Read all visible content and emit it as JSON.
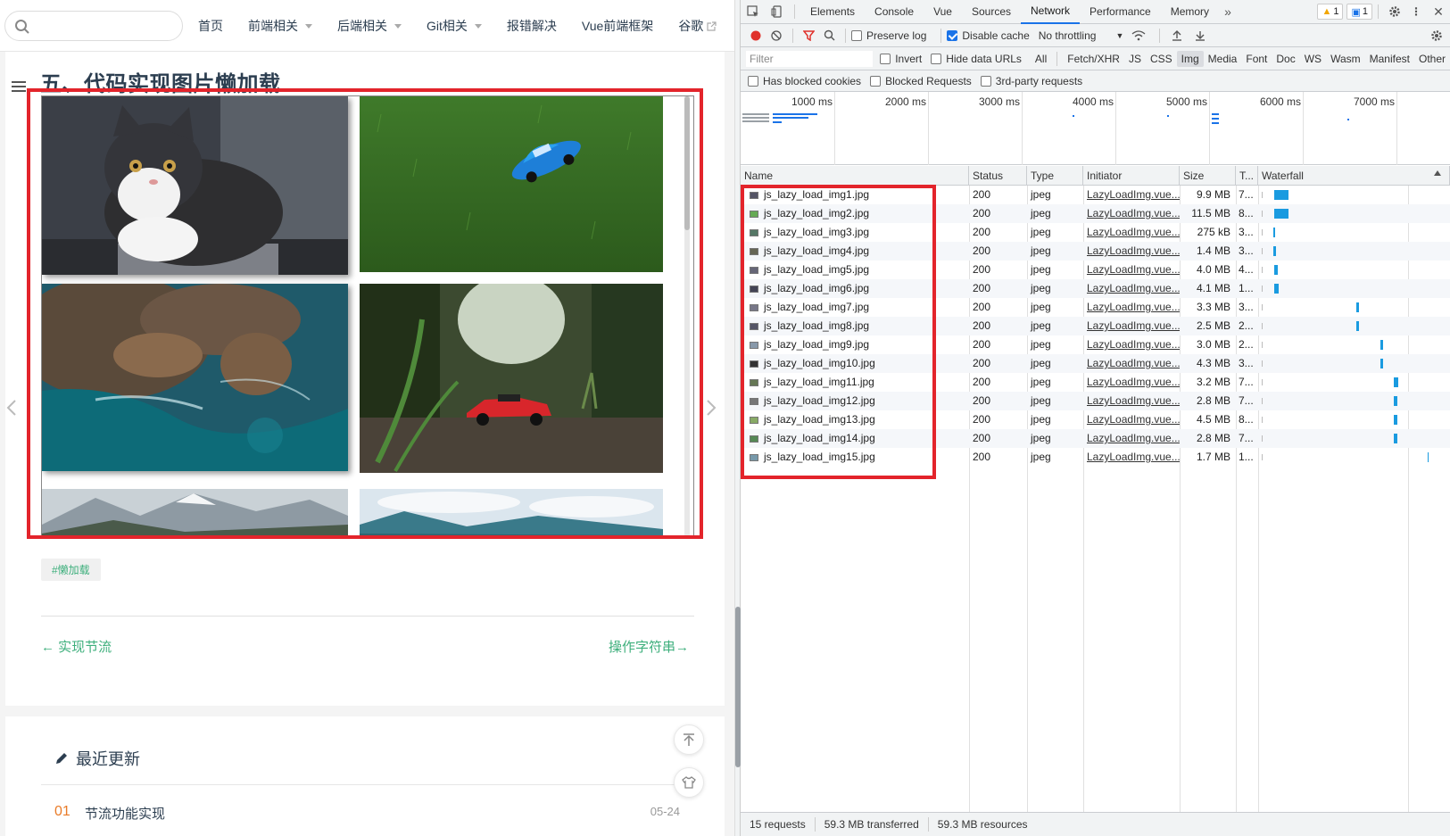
{
  "nav": {
    "items": [
      {
        "label": "首页",
        "caret": false
      },
      {
        "label": "前端相关",
        "caret": true
      },
      {
        "label": "后端相关",
        "caret": true
      },
      {
        "label": "Git相关",
        "caret": true
      },
      {
        "label": "报错解决",
        "caret": false
      },
      {
        "label": "Vue前端框架",
        "caret": false
      },
      {
        "label": "谷歌",
        "caret": false,
        "external": true
      }
    ]
  },
  "article": {
    "title": "五、代码实现图片懒加载",
    "tag": "#懒加载",
    "prev_link": "← 实现节流",
    "next_link": "操作字符串→"
  },
  "recent": {
    "title": "最近更新",
    "items": [
      {
        "num": "01",
        "text": "节流功能实现",
        "date": "05-24"
      }
    ]
  },
  "devtools": {
    "tabs": [
      "Elements",
      "Console",
      "Vue",
      "Sources",
      "Network",
      "Performance",
      "Memory"
    ],
    "active_tab": "Network",
    "warnings": "1",
    "messages": "1",
    "preserve_log": "Preserve log",
    "disable_cache": "Disable cache",
    "throttling": "No throttling",
    "filter_placeholder": "Filter",
    "invert": "Invert",
    "hide_data_urls": "Hide data URLs",
    "filter_types": [
      "All",
      "Fetch/XHR",
      "JS",
      "CSS",
      "Img",
      "Media",
      "Font",
      "Doc",
      "WS",
      "Wasm",
      "Manifest",
      "Other"
    ],
    "active_filter": "Img",
    "has_blocked_cookies": "Has blocked cookies",
    "blocked_requests": "Blocked Requests",
    "third_party": "3rd-party requests",
    "timeline_labels": [
      "1000 ms",
      "2000 ms",
      "3000 ms",
      "4000 ms",
      "5000 ms",
      "6000 ms",
      "7000 ms"
    ],
    "columns": [
      "Name",
      "Status",
      "Type",
      "Initiator",
      "Size",
      "T...",
      "Waterfall"
    ],
    "rows": [
      {
        "name": "js_lazy_load_img1.jpg",
        "status": "200",
        "type": "jpeg",
        "initiator": "LazyLoadImg.vue...",
        "size": "9.9 MB",
        "time": "7..."
      },
      {
        "name": "js_lazy_load_img2.jpg",
        "status": "200",
        "type": "jpeg",
        "initiator": "LazyLoadImg.vue...",
        "size": "11.5 MB",
        "time": "8..."
      },
      {
        "name": "js_lazy_load_img3.jpg",
        "status": "200",
        "type": "jpeg",
        "initiator": "LazyLoadImg.vue...",
        "size": "275 kB",
        "time": "3..."
      },
      {
        "name": "js_lazy_load_img4.jpg",
        "status": "200",
        "type": "jpeg",
        "initiator": "LazyLoadImg.vue...",
        "size": "1.4 MB",
        "time": "3..."
      },
      {
        "name": "js_lazy_load_img5.jpg",
        "status": "200",
        "type": "jpeg",
        "initiator": "LazyLoadImg.vue...",
        "size": "4.0 MB",
        "time": "4..."
      },
      {
        "name": "js_lazy_load_img6.jpg",
        "status": "200",
        "type": "jpeg",
        "initiator": "LazyLoadImg.vue...",
        "size": "4.1 MB",
        "time": "1..."
      },
      {
        "name": "js_lazy_load_img7.jpg",
        "status": "200",
        "type": "jpeg",
        "initiator": "LazyLoadImg.vue...",
        "size": "3.3 MB",
        "time": "3..."
      },
      {
        "name": "js_lazy_load_img8.jpg",
        "status": "200",
        "type": "jpeg",
        "initiator": "LazyLoadImg.vue...",
        "size": "2.5 MB",
        "time": "2..."
      },
      {
        "name": "js_lazy_load_img9.jpg",
        "status": "200",
        "type": "jpeg",
        "initiator": "LazyLoadImg.vue...",
        "size": "3.0 MB",
        "time": "2..."
      },
      {
        "name": "js_lazy_load_img10.jpg",
        "status": "200",
        "type": "jpeg",
        "initiator": "LazyLoadImg.vue...",
        "size": "4.3 MB",
        "time": "3..."
      },
      {
        "name": "js_lazy_load_img11.jpg",
        "status": "200",
        "type": "jpeg",
        "initiator": "LazyLoadImg.vue...",
        "size": "3.2 MB",
        "time": "7..."
      },
      {
        "name": "js_lazy_load_img12.jpg",
        "status": "200",
        "type": "jpeg",
        "initiator": "LazyLoadImg.vue...",
        "size": "2.8 MB",
        "time": "7..."
      },
      {
        "name": "js_lazy_load_img13.jpg",
        "status": "200",
        "type": "jpeg",
        "initiator": "LazyLoadImg.vue...",
        "size": "4.5 MB",
        "time": "8..."
      },
      {
        "name": "js_lazy_load_img14.jpg",
        "status": "200",
        "type": "jpeg",
        "initiator": "LazyLoadImg.vue...",
        "size": "2.8 MB",
        "time": "7..."
      },
      {
        "name": "js_lazy_load_img15.jpg",
        "status": "200",
        "type": "jpeg",
        "initiator": "LazyLoadImg.vue...",
        "size": "1.7 MB",
        "time": "1..."
      }
    ],
    "status_bar": {
      "requests": "15 requests",
      "transferred": "59.3 MB transferred",
      "resources": "59.3 MB resources"
    }
  },
  "colors": {
    "highlight": "#e3242b",
    "accent": "#3eaf7c",
    "devtools_blue": "#1a73e8"
  }
}
